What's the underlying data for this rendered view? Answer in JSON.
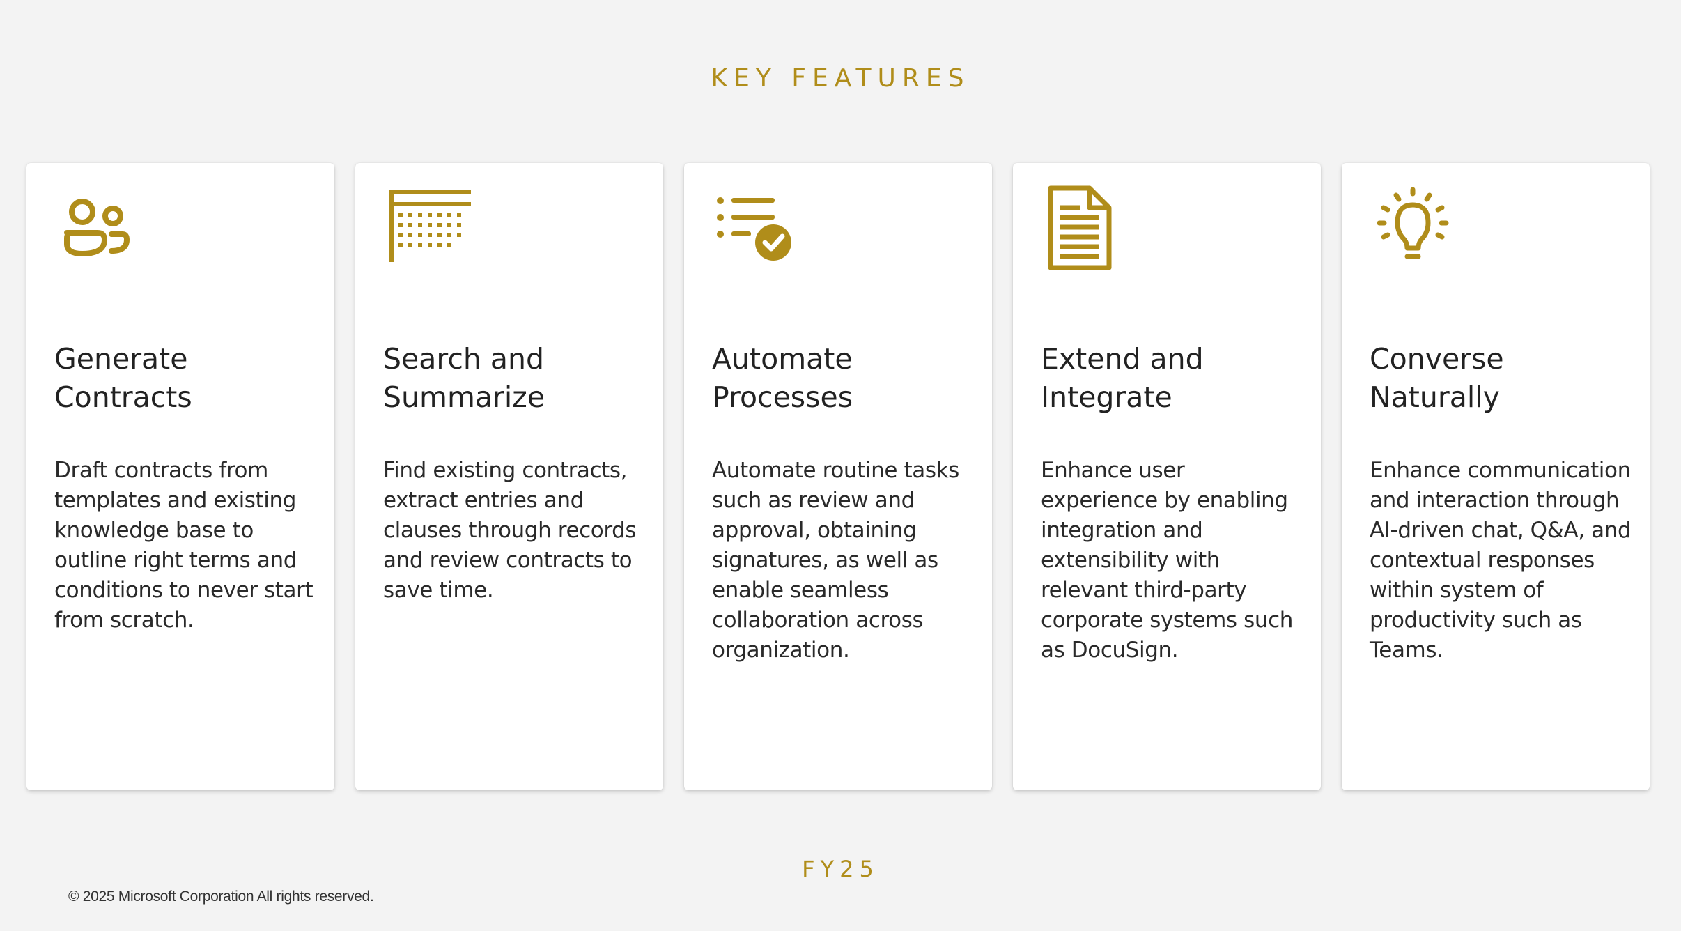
{
  "header": {
    "title": "KEY FEATURES"
  },
  "cards": [
    {
      "icon": "people-icon",
      "title": "Generate Contracts",
      "description": "Draft contracts from templates and existing knowledge base to outline right terms and conditions to never start from scratch."
    },
    {
      "icon": "calendar-grid-icon",
      "title": "Search and Summarize",
      "description": "Find existing contracts, extract entries and clauses through records and review contracts to save time."
    },
    {
      "icon": "checklist-icon",
      "title": "Automate Processes",
      "description": "Automate routine tasks such as review and approval, obtaining signatures, as well as enable seamless collaboration across organization."
    },
    {
      "icon": "document-icon",
      "title": "Extend and Integrate",
      "description": "Enhance user experience by enabling integration and extensibility with relevant third-party corporate systems such as DocuSign."
    },
    {
      "icon": "lightbulb-icon",
      "title": "Converse Naturally",
      "description": "Enhance communication and interaction through AI-driven chat, Q&A, and contextual responses within system of productivity such as Teams."
    }
  ],
  "footer": {
    "label": "FY25",
    "copyright": "© 2025 Microsoft Corporation All rights reserved."
  },
  "colors": {
    "accent": "#b08d1a",
    "background": "#f3f3f3",
    "card": "#ffffff"
  }
}
